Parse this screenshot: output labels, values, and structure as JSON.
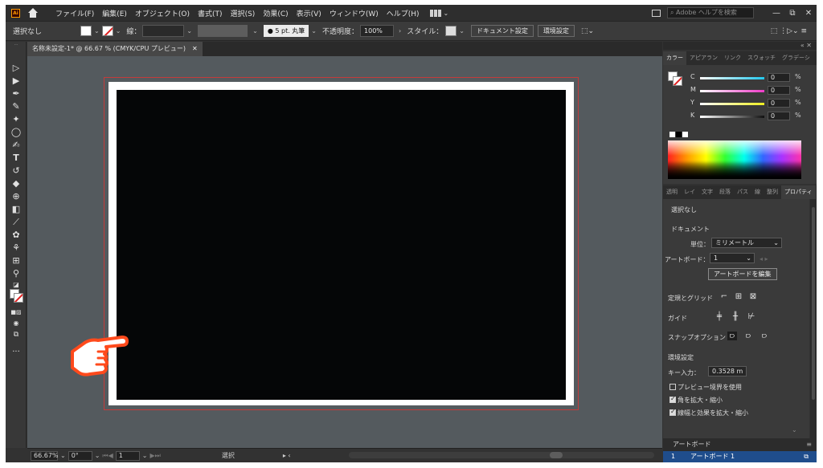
{
  "menubar": {
    "logo": "Ai",
    "items": [
      "ファイル(F)",
      "編集(E)",
      "オブジェクト(O)",
      "書式(T)",
      "選択(S)",
      "効果(C)",
      "表示(V)",
      "ウィンドウ(W)",
      "ヘルプ(H)"
    ],
    "help_search_placeholder": "Adobe ヘルプを検索",
    "window_buttons": [
      "—",
      "⧉",
      "✕"
    ]
  },
  "controlbar": {
    "selection_label": "選択なし",
    "stroke_label": "線：",
    "brush_label": "●  5 pt. 丸筆",
    "opacity_label": "不透明度：",
    "opacity_value": "100%",
    "style_label": "スタイル：",
    "document_setup_button": "ドキュメント設定",
    "preferences_button": "環境設定"
  },
  "document": {
    "tab_title": "名称未設定-1* @ 66.67 % (CMYK/CPU プレビュー)",
    "tab_close": "✕"
  },
  "statusbar": {
    "zoom": "66.67%",
    "rotation": "0°",
    "artboard_number": "1",
    "tool_label": "選択"
  },
  "color_panel": {
    "tabs": [
      "カラー",
      "アピアラン",
      "リンク",
      "スウォッチ",
      "グラデーシ"
    ],
    "channels": [
      {
        "label": "C",
        "value": "0",
        "unit": "%",
        "color": "#22c8ee"
      },
      {
        "label": "M",
        "value": "0",
        "unit": "%",
        "color": "#ee3cc8"
      },
      {
        "label": "Y",
        "value": "0",
        "unit": "%",
        "color": "#eeee22"
      },
      {
        "label": "K",
        "value": "0",
        "unit": "%",
        "color": "#dddddd"
      }
    ]
  },
  "properties_panel": {
    "tabs": [
      "透明",
      "レイ",
      "文字",
      "段落",
      "パス",
      "線",
      "整列",
      "プロパティ"
    ],
    "selection": "選択なし",
    "document_heading": "ドキュメント",
    "units_label": "単位：",
    "units_value": "ミリメートル",
    "artboard_label": "アートボード：",
    "artboard_value": "1",
    "edit_artboard_button": "アートボードを編集",
    "rulers_grid_label": "定規とグリッド",
    "guides_label": "ガイド",
    "snap_label": "スナップオプション",
    "preferences_heading": "環境設定",
    "key_increment_label": "キー入力：",
    "key_increment_value": "0.3528 m",
    "checkbox_preview_bounds": "プレビュー境界を使用",
    "checkbox_scale_corners": "角を拡大・縮小",
    "checkbox_scale_strokes": "線幅と効果を拡大・縮小",
    "preview_bounds_checked": false,
    "scale_corners_checked": true,
    "scale_strokes_checked": true
  },
  "artboards_panel": {
    "title": "アートボード",
    "row_number": "1",
    "row_name": "アートボード 1"
  },
  "colors": {
    "canvas": "#545a5e",
    "artboard_fill": "#050607",
    "bleed_guide": "#c43b3b",
    "hand_pointer": "#ff4a1c"
  }
}
